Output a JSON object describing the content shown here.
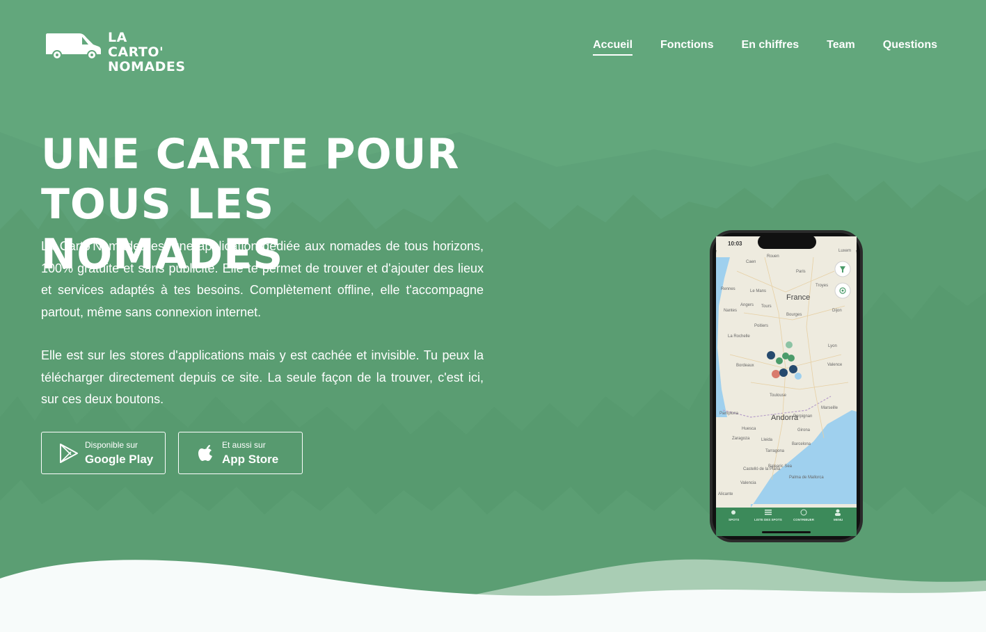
{
  "brand": {
    "line1": "LA CARTO'",
    "line2": "NOMADES"
  },
  "nav": {
    "items": [
      {
        "label": "Accueil",
        "active": true
      },
      {
        "label": "Fonctions",
        "active": false
      },
      {
        "label": "En chiffres",
        "active": false
      },
      {
        "label": "Team",
        "active": false
      },
      {
        "label": "Questions",
        "active": false
      }
    ]
  },
  "hero": {
    "title_line1": "UNE CARTE POUR",
    "title_line2": "TOUS LES NOMADES",
    "paragraph1": "La Carto'Nomades est une application dédiée aux nomades de tous horizons, 100% gratuite et sans publicité. Elle te permet de trouver et d'ajouter des lieux et services adaptés à tes besoins. Complètement offline, elle t'accompagne partout, même sans connexion internet.",
    "paragraph2": "Elle est sur les stores d'applications mais y est cachée et invisible. Tu peux la télécharger directement depuis ce site. La seule façon de la trouver, c'est ici, sur ces deux boutons."
  },
  "buttons": {
    "google": {
      "small": "Disponible sur",
      "big": "Google Play",
      "icon": "google-play-icon"
    },
    "apple": {
      "small": "Et aussi sur",
      "big": "App Store",
      "icon": "apple-icon"
    }
  },
  "phone": {
    "time": "10:03",
    "map_labels": {
      "france": "France",
      "andorra": "Andorra",
      "rouen": "Rouen",
      "paris": "Paris",
      "rennes": "Rennes",
      "le_mans": "Le Mans",
      "angers": "Angers",
      "tours": "Tours",
      "nantes": "Nantes",
      "poitiers": "Poitiers",
      "bourges": "Bourges",
      "la_rochelle": "La Rochelle",
      "bordeaux": "Bordeaux",
      "lyon": "Lyon",
      "valence": "Valence",
      "toulouse": "Toulouse",
      "marseille": "Marseille",
      "zaragoza": "Zaragoza",
      "barcelona": "Barcelona",
      "valencia": "Valencia",
      "pamplona": "Pamplona",
      "lleida": "Lleida",
      "tarragona": "Tarragona",
      "dijon": "Dijon",
      "troyes": "Troyes",
      "perpignan": "Perpignan",
      "girona": "Girona",
      "huesca": "Huesca",
      "palma": "Palma de Mallorca",
      "balearic": "Balearic Sea",
      "luxem": "Luxem",
      "caen": "Caen",
      "alicante": "Alicante",
      "castello": "Castelló de la Plana"
    },
    "tabs": [
      "SPOTS",
      "LISTE DES SPOTS",
      "CONTRIBUER",
      "MENU"
    ]
  },
  "colors": {
    "background": "#62a77c",
    "mountain_far": "#5a9f74",
    "forest": "#529569",
    "wave_light": "#a9cdb4",
    "wave_white": "#f7fbfa",
    "map_sea": "#9fd0ee",
    "map_land": "#eeebdf",
    "tab_bar": "#3c8a5a"
  }
}
